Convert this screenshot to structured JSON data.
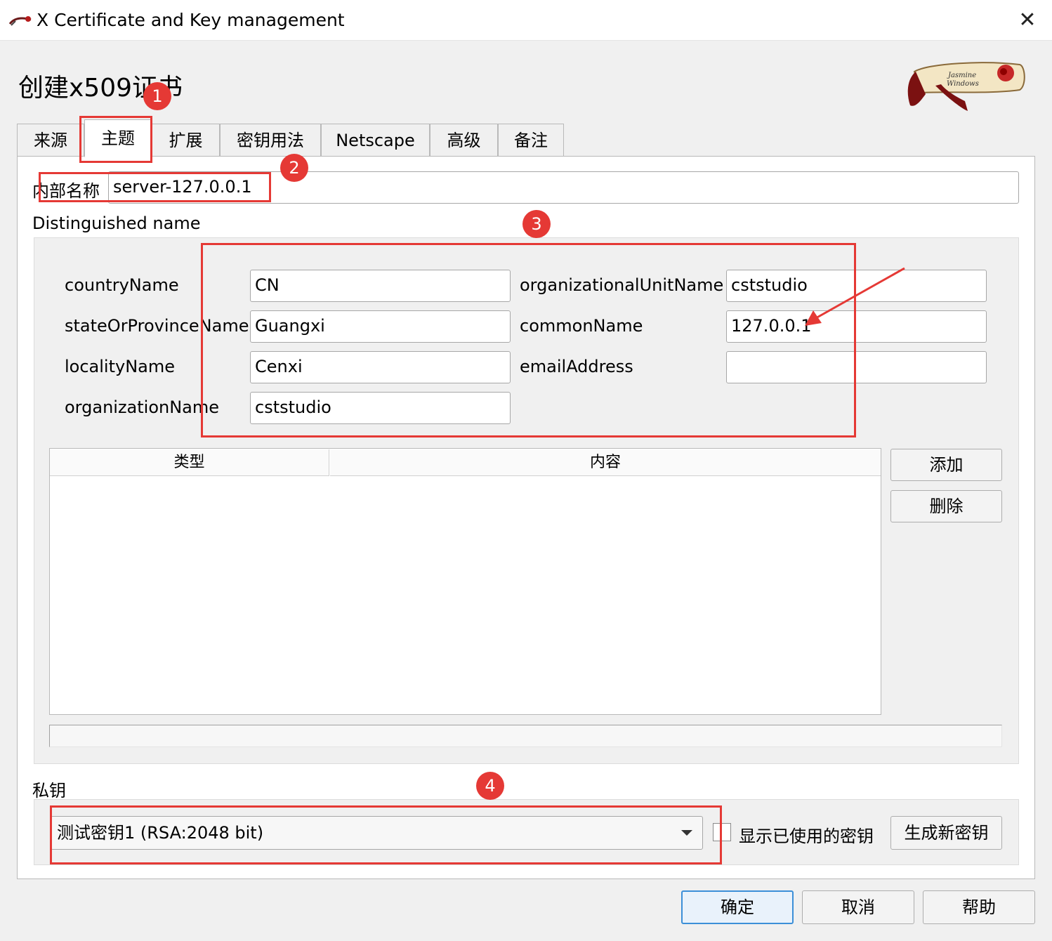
{
  "window": {
    "title": "X Certificate and Key management",
    "close_glyph": "✕",
    "app_icon": "rose-icon"
  },
  "heading": "创建x509证书",
  "tabs": [
    {
      "label": "来源"
    },
    {
      "label": "主题"
    },
    {
      "label": "扩展"
    },
    {
      "label": "密钥用法"
    },
    {
      "label": "Netscape"
    },
    {
      "label": "高级"
    },
    {
      "label": "备注"
    }
  ],
  "internal_name": {
    "label": "内部名称",
    "value": "server-127.0.0.1"
  },
  "dn": {
    "title": "Distinguished name",
    "left": [
      {
        "label": "countryName",
        "value": "CN"
      },
      {
        "label": "stateOrProvinceName",
        "value": "Guangxi"
      },
      {
        "label": "localityName",
        "value": "Cenxi"
      },
      {
        "label": "organizationName",
        "value": "cststudio"
      }
    ],
    "right": [
      {
        "label": "organizationalUnitName",
        "value": "cststudio"
      },
      {
        "label": "commonName",
        "value": "127.0.0.1"
      },
      {
        "label": "emailAddress",
        "value": ""
      }
    ],
    "table_headers": {
      "type": "类型",
      "content": "内容"
    },
    "add_label": "添加",
    "delete_label": "删除"
  },
  "private_key": {
    "title": "私钥",
    "selected": "测试密钥1 (RSA:2048 bit)",
    "show_used_label": "显示已使用的密钥",
    "show_used_checked": false,
    "generate_label": "生成新密钥"
  },
  "footer": {
    "ok": "确定",
    "cancel": "取消",
    "help": "帮助"
  },
  "annotations": [
    "1",
    "2",
    "3",
    "4"
  ],
  "colors": {
    "annotation": "#e53935",
    "primary_border": "#3c8fd8"
  }
}
